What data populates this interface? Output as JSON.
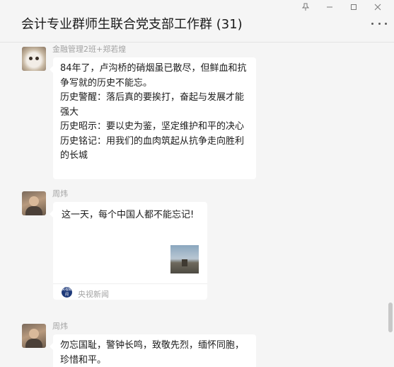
{
  "window": {
    "title": "会计专业群师生联合党支部工作群 (31)",
    "controls": [
      "pin",
      "minimize",
      "maximize",
      "close"
    ]
  },
  "messages": [
    {
      "sender": "金融管理2班+郑若煌",
      "avatar": "cat-avatar",
      "lines": [
        "84年了，卢沟桥的硝烟虽已散尽，但鲜血和抗争写就的历史不能忘。",
        "历史警醒：落后真的要挨打，奋起与发展才能强大",
        "历史昭示：要以史为鉴，坚定维护和平的决心",
        "历史铭记：用我们的血肉筑起从抗争走向胜利的长城"
      ]
    },
    {
      "sender": "周炜",
      "avatar": "person-avatar",
      "card": {
        "title": "这一天，每个中国人都不能忘记!",
        "source": "央视新闻",
        "source_icon_text": "央视新闻"
      }
    },
    {
      "sender": "周炜",
      "avatar": "person-avatar",
      "lines": [
        "勿忘国耻，警钟长鸣，致敬先烈，缅怀同胞，珍惜和平。"
      ]
    }
  ]
}
